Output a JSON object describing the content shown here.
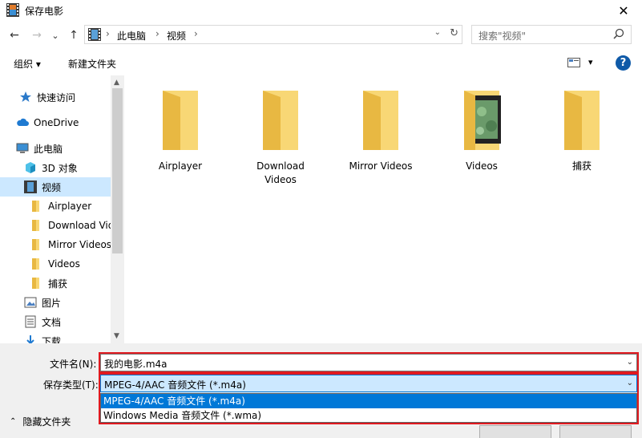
{
  "window": {
    "title": "保存电影",
    "close": "✕"
  },
  "nav": {
    "back": "←",
    "forward": "→",
    "history": "⌄",
    "up": "↑"
  },
  "address": {
    "crumbs": [
      "此电脑",
      "视频"
    ],
    "sep": "›",
    "dropdown": "⌄",
    "refresh": "↻"
  },
  "search": {
    "placeholder": "搜索\"视频\""
  },
  "toolbar": {
    "organize": "组织 ▾",
    "new_folder": "新建文件夹",
    "view_menu": "▾",
    "help": "?"
  },
  "sidebar": {
    "items": [
      {
        "label": "快速访问",
        "icon": "star-icon"
      },
      {
        "label": "OneDrive",
        "icon": "cloud-icon"
      },
      {
        "label": "此电脑",
        "icon": "computer-icon"
      },
      {
        "label": "3D 对象",
        "icon": "cube-icon"
      },
      {
        "label": "视频",
        "icon": "film-icon"
      },
      {
        "label": "Airplayer",
        "icon": "folder-icon"
      },
      {
        "label": "Download Videos",
        "icon": "folder-icon"
      },
      {
        "label": "Mirror Videos",
        "icon": "folder-icon"
      },
      {
        "label": "Videos",
        "icon": "folder-icon"
      },
      {
        "label": "捕获",
        "icon": "folder-icon"
      },
      {
        "label": "图片",
        "icon": "picture-icon"
      },
      {
        "label": "文档",
        "icon": "document-icon"
      },
      {
        "label": "下载",
        "icon": "download-icon"
      }
    ],
    "scroll_up": "▲",
    "scroll_down": "▼"
  },
  "files": [
    {
      "label": "Airplayer",
      "type": "folder"
    },
    {
      "label": "Download Videos",
      "type": "folder"
    },
    {
      "label": "Mirror Videos",
      "type": "folder"
    },
    {
      "label": "Videos",
      "type": "folder-with-preview"
    },
    {
      "label": "捕获",
      "type": "folder"
    }
  ],
  "form": {
    "filename_label": "文件名(N):",
    "filename_value": "我的电影.m4a",
    "filetype_label": "保存类型(T):",
    "filetype_value": "MPEG-4/AAC 音频文件 (*.m4a)",
    "dropdown_arrow": "⌄",
    "filetype_options": [
      "MPEG-4/AAC 音频文件 (*.m4a)",
      "Windows Media 音频文件 (*.wma)"
    ]
  },
  "footer": {
    "hide_folders": "隐藏文件夹",
    "chevron": "⌃"
  },
  "colors": {
    "accent": "#0078d7",
    "selection": "#cce8ff",
    "folder": "#f8d775",
    "highlight_box": "#e0191f"
  }
}
